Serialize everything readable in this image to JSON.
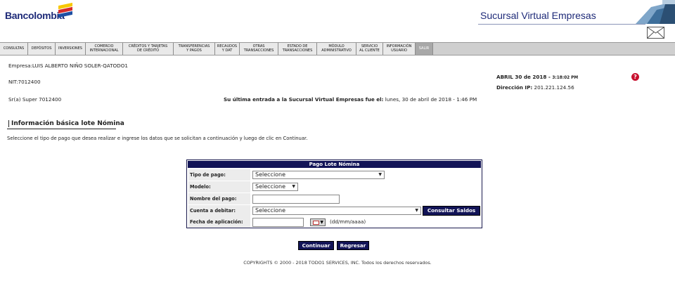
{
  "header": {
    "logo_text": "Bancolombia",
    "logo_colors": [
      "#f7c800",
      "#d62b2b",
      "#1e4fa3"
    ],
    "site_title": "Sucursal Virtual Empresas",
    "mail_icon": "envelope-icon"
  },
  "nav": [
    "CONSULTAS",
    "DEPÓSITOS",
    "INVERSIONES",
    "COMERCIO\nINTERNACIONAL",
    "CRÉDITOS Y TARJETAS\nDE CRÉDITO",
    "TRANSFERENCIAS\nY PAGOS",
    "RECAUDOS\nY DAT",
    "OTRAS\nTRANSACCIONES",
    "ESTADO DE\nTRANSACCIONES",
    "MÓDULO\nADMINISTRATIVO",
    "SERVICIO\nAL CLIENTE",
    "INFORMACIÓN\nUSUARIO",
    "SALIR"
  ],
  "info": {
    "empresa": "Empresa:LUIS ALBERTO NIÑO SOLER-QATODO1",
    "nit": "NIT:7012400",
    "user": "Sr(a) Super 7012400",
    "date_strong": "ABRIL 30 de 2018 - ",
    "date_time": "3:18:02 PM",
    "ip_label": "Dirección IP:",
    "ip_value": " 201.221.124.56",
    "last_entry_label": "Su última entrada a la Sucursal Virtual Empresas fue el:",
    "last_entry_value": " lunes, 30 de abril de 2018 - 1:46 PM",
    "help_icon": "help-icon"
  },
  "section": {
    "title": "Información básica lote Nómina",
    "instructions": "Seleccione el tipo de pago que desea realizar e ingrese los datos que se solicitan a continuación y luego de clic en Continuar."
  },
  "form": {
    "header": "Pago Lote Nómina",
    "tipo_pago_label": "Tipo de pago:",
    "tipo_pago_value": "Seleccione",
    "modelo_label": "Modelo:",
    "modelo_value": "Seleccione",
    "nombre_label": "Nombre del pago:",
    "nombre_value": "",
    "cuenta_label": "Cuenta a debitar:",
    "cuenta_value": "Seleccione",
    "consultar_label": "Consultar Saldos",
    "fecha_label": "Fecha de aplicación:",
    "fecha_value": "",
    "fecha_hint": "(dd/mm/aaaa)"
  },
  "actions": {
    "continuar": "Continuar",
    "regresar": "Regresar"
  },
  "footer": "COPYRIGHTS © 2000 - 2018 TODO1 SERVICES, INC. Todos los derechos reservados."
}
